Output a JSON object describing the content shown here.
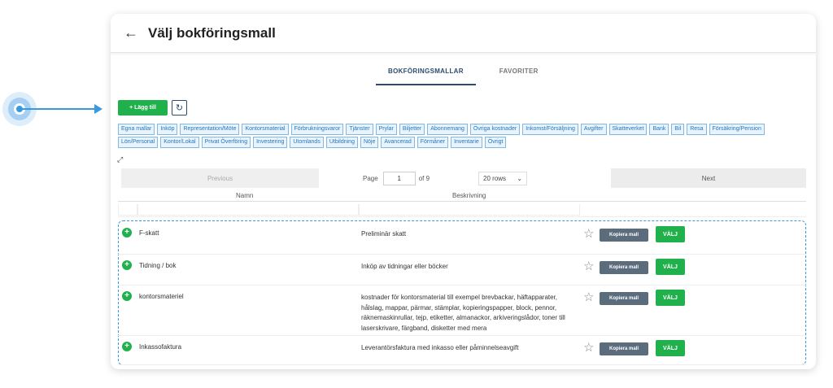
{
  "header": {
    "title": "Välj bokföringsmall"
  },
  "tabs": [
    {
      "label": "BOKFÖRINGSMALLAR",
      "active": true
    },
    {
      "label": "FAVORITER",
      "active": false
    }
  ],
  "toolbar": {
    "add_label": "+ Lägg till",
    "refresh_icon": "refresh-icon"
  },
  "chips": [
    "Egna mallar",
    "Inköp",
    "Representation/Möte",
    "Kontorsmaterial",
    "Förbrukningsvaror",
    "Tjänster",
    "Prylar",
    "Biljetter",
    "Abonnemang",
    "Övriga kostnader",
    "Inkomst/Försäljning",
    "Avgifter",
    "Skatteverket",
    "Bank",
    "Bil",
    "Resa",
    "Försäkring/Pension",
    "Lön/Personal",
    "Kontor/Lokal",
    "Privat Överföring",
    "Investering",
    "Utomlands",
    "Utbildning",
    "Nöje",
    "Avancerad",
    "Förmåner",
    "Inventarie",
    "Övrigt"
  ],
  "pager": {
    "previous": "Previous",
    "page_label": "Page",
    "page_value": "1",
    "of_label": "of 9",
    "rows": "20 rows",
    "next": "Next"
  },
  "columns": {
    "name": "Namn",
    "description": "Beskrivning"
  },
  "rows": [
    {
      "name": "F-skatt",
      "description": "Preliminär skatt",
      "copy": "Kopiera mall",
      "select": "VÄLJ"
    },
    {
      "name": "Tidning / bok",
      "description": "Inköp av tidningar eller böcker",
      "copy": "Kopiera mall",
      "select": "VÄLJ"
    },
    {
      "name": "kontorsmateriel",
      "description": "kostnader för kontorsmaterial till exempel brevbackar, häftapparater, hålslag, mappar, pärmar, stämplar, kopieringspapper, block, pennor, räknemaskinrullar, tejp, etiketter, almanackor, arkiveringslådor, toner till laserskrivare, färgband, disketter med mera",
      "copy": "Kopiera mall",
      "select": "VÄLJ"
    },
    {
      "name": "Inkassofaktura",
      "description": "Leverantörsfaktura med inkasso eller påminnelseavgift",
      "copy": "Kopiera mall",
      "select": "VÄLJ"
    }
  ],
  "colors": {
    "green": "#20b14c",
    "navy": "#2c4c70",
    "accent": "#3a98e0"
  }
}
